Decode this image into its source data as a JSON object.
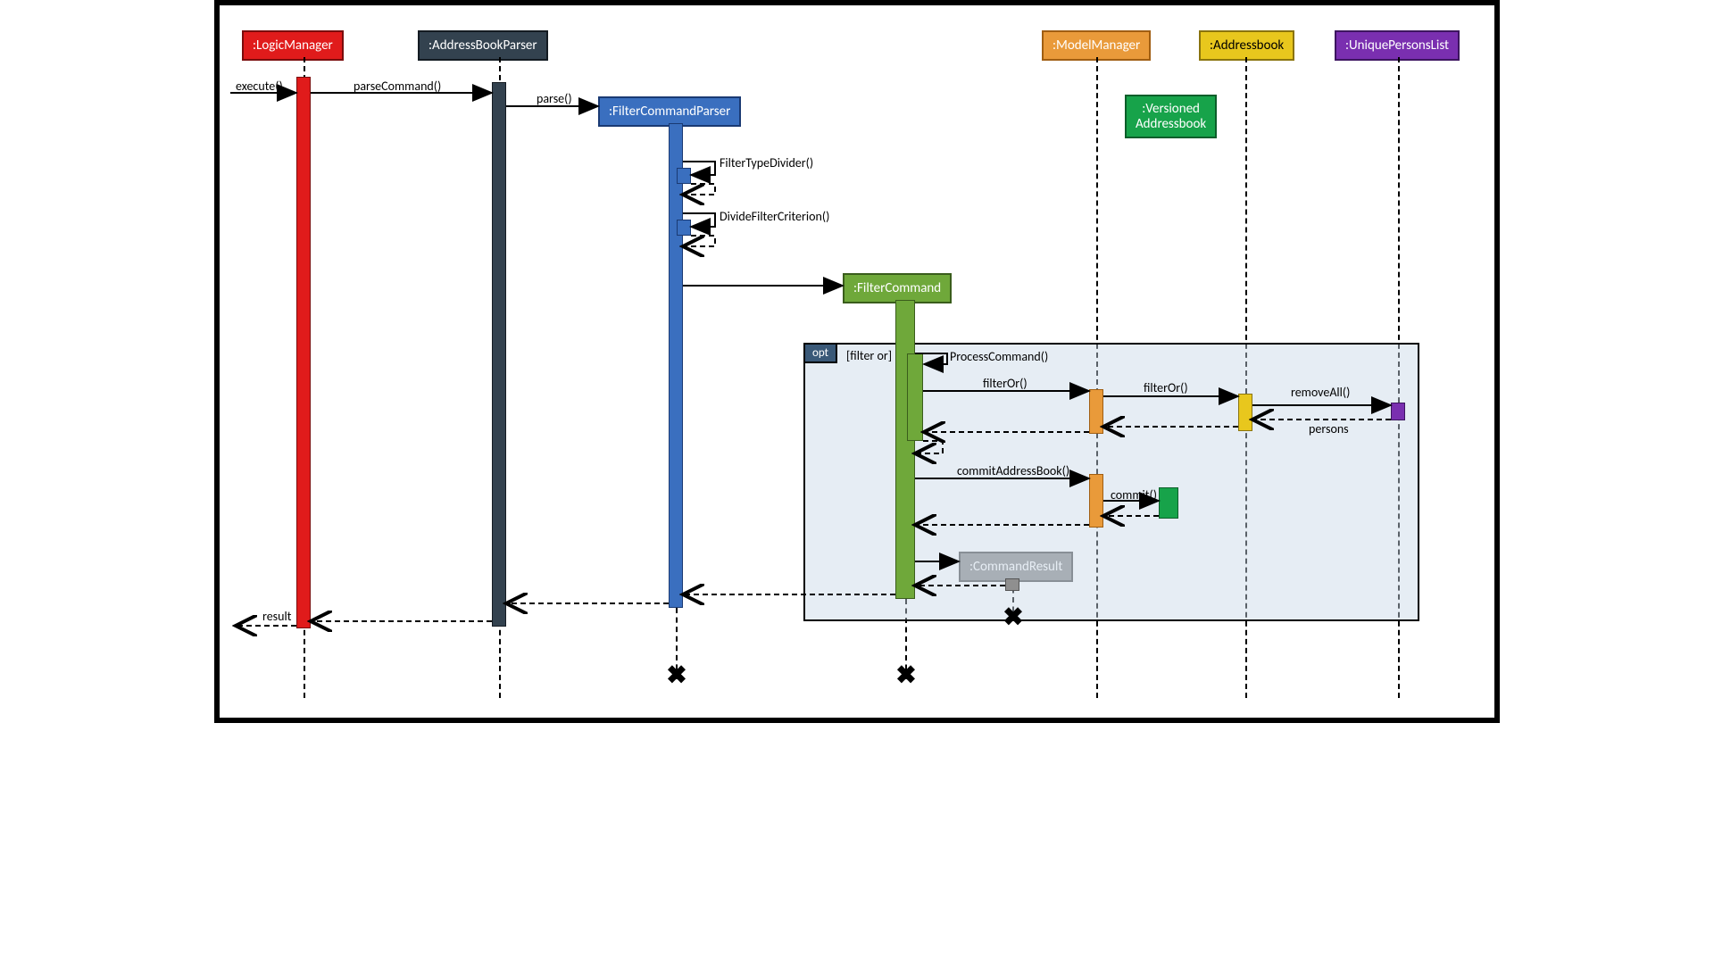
{
  "diagram_type": "UML Sequence Diagram",
  "lifelines": {
    "logicManager": {
      "label": ":LogicManager",
      "fill": "#e01b1b",
      "border": "#7a0c0c"
    },
    "addressBookParser": {
      "label": ":AddressBookParser",
      "fill": "#33424f",
      "border": "#141b22"
    },
    "filterCommandParser": {
      "label": ":FilterCommandParser",
      "fill": "#3a6fbf",
      "border": "#1a3a73"
    },
    "filterCommand": {
      "label": ":FilterCommand",
      "fill": "#6fa83a",
      "border": "#3a5d1c"
    },
    "commandResult": {
      "label": ":CommandResult",
      "fill": "#8f8f8f",
      "border": "#555555"
    },
    "modelManager": {
      "label": ":ModelManager",
      "fill": "#e99a3a",
      "border": "#a05e12"
    },
    "versionedAddressbook": {
      "label": ":Versioned\nAddressbook",
      "fill": "#17a34a",
      "border": "#0c5e2a"
    },
    "addressbook": {
      "label": ":Addressbook",
      "fill": "#e8c71d",
      "border": "#8a740d"
    },
    "uniquePersonsList": {
      "label": ":UniquePersonsList",
      "fill": "#7a2fb0",
      "border": "#3d1560"
    }
  },
  "messages": {
    "execute": "execute()",
    "parseCommand": "parseCommand()",
    "parse": "parse()",
    "filterTypeDivider": "FilterTypeDivider()",
    "divideFilterCriterion": "DivideFilterCriterion()",
    "processCommand": "ProcessCommand()",
    "filterOr1": "filterOr()",
    "filterOr2": "filterOr()",
    "removeAll": "removeAll()",
    "persons": "persons",
    "commitAddressBook": "commitAddressBook()",
    "commit": "commit()",
    "result": "result"
  },
  "fragment": {
    "operator": "opt",
    "guard": "[filter or]"
  }
}
